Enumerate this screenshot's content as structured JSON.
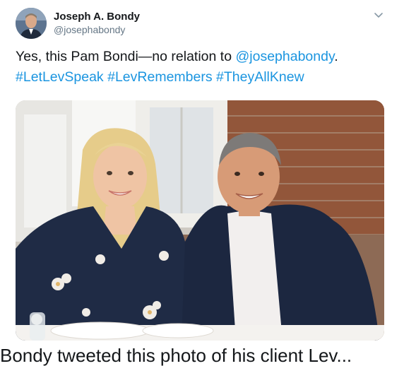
{
  "tweet": {
    "author_name": "Joseph A. Bondy",
    "author_handle": "@josephabondy",
    "text_lead": "Yes, this Pam Bondi—no relation to ",
    "mention": "@josephabondy",
    "text_period": ".",
    "hashtags": [
      "#LetLevSpeak",
      "#LevRemembers",
      "#TheyAllKnew"
    ],
    "menu_icon": "chevron-down-icon",
    "link_color": "#1b95e0"
  },
  "caption_partial": "Bondy tweeted this photo of his client Lev..."
}
